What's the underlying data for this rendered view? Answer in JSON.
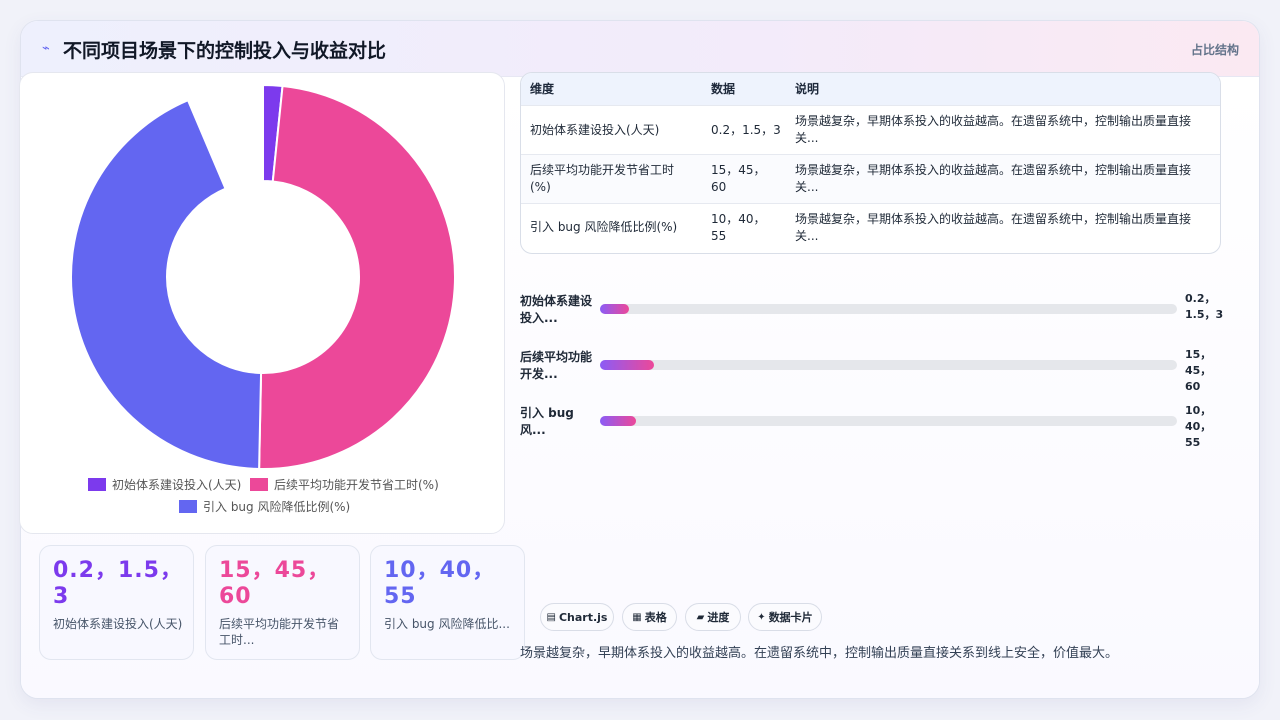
{
  "header": {
    "logo_icon": "⌁",
    "title": "不同项目场景下的控制投入与收益对比",
    "tag": "占比结构"
  },
  "chart_data": {
    "type": "pie",
    "variant": "doughnut",
    "categories": [
      "初始体系建设投入(人天)",
      "后续平均功能开发节省工时(%)",
      "引入 bug 风险降低比例(%)"
    ],
    "values": [
      1.5,
      45,
      40
    ],
    "colors": [
      "#7c3aed",
      "#ec4899",
      "#6366f1"
    ],
    "hidden_gap_note": "",
    "legend_position": "bottom"
  },
  "stats": [
    {
      "value": "0.2，1.5，3",
      "label": "初始体系建设投入(人天)",
      "color": "#7c3aed"
    },
    {
      "value": "15，45，60",
      "label": "后续平均功能开发节省工时...",
      "color": "#ec4899"
    },
    {
      "value": "10，40，55",
      "label": "引入 bug 风险降低比...",
      "color": "#6366f1"
    }
  ],
  "table": {
    "headers": [
      "维度",
      "数据",
      "说明"
    ],
    "rows": [
      {
        "dim": "初始体系建设投入(人天)",
        "data": "0.2，1.5，3",
        "desc": "场景越复杂，早期体系投入的收益越高。在遗留系统中，控制输出质量直接关..."
      },
      {
        "dim": "后续平均功能开发节省工时(%)",
        "data": "15，45，60",
        "desc": "场景越复杂，早期体系投入的收益越高。在遗留系统中，控制输出质量直接关..."
      },
      {
        "dim": "引入 bug 风险降低比例(%)",
        "data": "10，40，55",
        "desc": "场景越复杂，早期体系投入的收益越高。在遗留系统中，控制输出质量直接关..."
      }
    ]
  },
  "progress": [
    {
      "label": "初始体系建设投入...",
      "value": "0.2，1.5，3",
      "fraction": 0.05
    },
    {
      "label": "后续平均功能开发...",
      "value": "15，45，60",
      "fraction": 0.094
    },
    {
      "label": "引入 bug 风...",
      "value": "10，40，55",
      "fraction": 0.062
    }
  ],
  "chips": [
    {
      "icon": "▤",
      "label": "Chart.js"
    },
    {
      "icon": "▦",
      "label": "表格"
    },
    {
      "icon": "▰",
      "label": "进度"
    },
    {
      "icon": "✦",
      "label": "数据卡片"
    }
  ],
  "footer": "场景越复杂，早期体系投入的收益越高。在遗留系统中，控制输出质量直接关系到线上安全，价值最大。"
}
